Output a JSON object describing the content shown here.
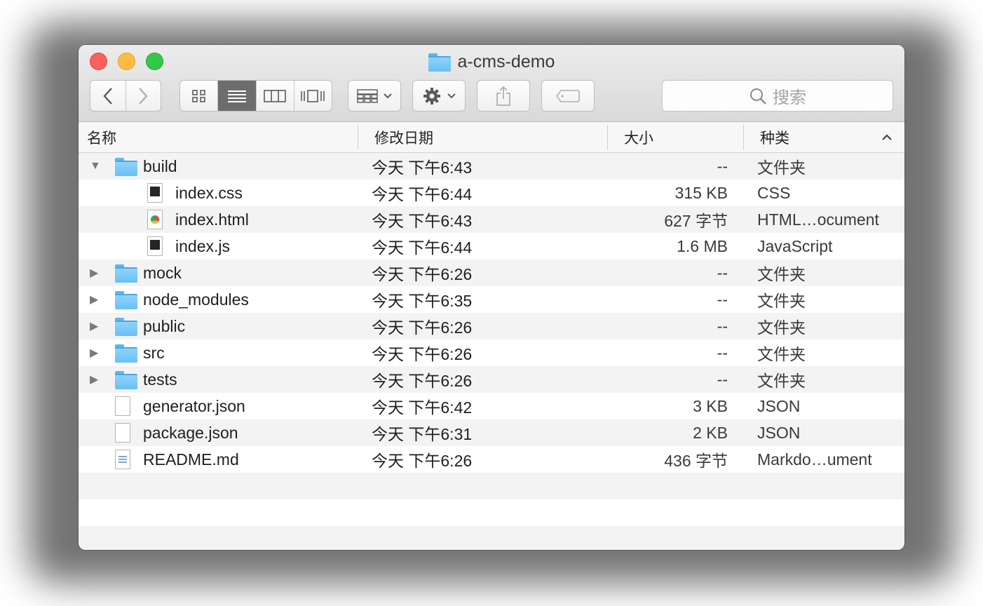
{
  "window": {
    "title": "a-cms-demo"
  },
  "toolbar": {
    "back_icon": "chevron-left-icon",
    "forward_icon": "chevron-right-icon",
    "view_modes": [
      "icon-view",
      "list-view",
      "column-view",
      "cover-flow-view"
    ],
    "active_view": "list-view",
    "search_placeholder": "搜索"
  },
  "columns": {
    "name": "名称",
    "date": "修改日期",
    "size": "大小",
    "kind": "种类"
  },
  "rows": [
    {
      "name": "build",
      "date": "今天 下午6:43",
      "size": "--",
      "kind": "文件夹",
      "type": "folder",
      "disclosure": "▼",
      "indent": 0
    },
    {
      "name": "index.css",
      "date": "今天 下午6:44",
      "size": "315 KB",
      "kind": "CSS",
      "type": "dark",
      "disclosure": "",
      "indent": 1
    },
    {
      "name": "index.html",
      "date": "今天 下午6:43",
      "size": "627 字节",
      "kind": "HTML…ocument",
      "type": "chrome",
      "disclosure": "",
      "indent": 1
    },
    {
      "name": "index.js",
      "date": "今天 下午6:44",
      "size": "1.6 MB",
      "kind": "JavaScript",
      "type": "dark",
      "disclosure": "",
      "indent": 1
    },
    {
      "name": "mock",
      "date": "今天 下午6:26",
      "size": "--",
      "kind": "文件夹",
      "type": "folder",
      "disclosure": "▶",
      "indent": 0
    },
    {
      "name": "node_modules",
      "date": "今天 下午6:35",
      "size": "--",
      "kind": "文件夹",
      "type": "folder",
      "disclosure": "▶",
      "indent": 0
    },
    {
      "name": "public",
      "date": "今天 下午6:26",
      "size": "--",
      "kind": "文件夹",
      "type": "folder",
      "disclosure": "▶",
      "indent": 0
    },
    {
      "name": "src",
      "date": "今天 下午6:26",
      "size": "--",
      "kind": "文件夹",
      "type": "folder",
      "disclosure": "▶",
      "indent": 0
    },
    {
      "name": "tests",
      "date": "今天 下午6:26",
      "size": "--",
      "kind": "文件夹",
      "type": "folder",
      "disclosure": "▶",
      "indent": 0
    },
    {
      "name": "generator.json",
      "date": "今天 下午6:42",
      "size": "3 KB",
      "kind": "JSON",
      "type": "plain",
      "disclosure": "",
      "indent": 0
    },
    {
      "name": "package.json",
      "date": "今天 下午6:31",
      "size": "2 KB",
      "kind": "JSON",
      "type": "plain",
      "disclosure": "",
      "indent": 0
    },
    {
      "name": "README.md",
      "date": "今天 下午6:26",
      "size": "436 字节",
      "kind": "Markdo…ument",
      "type": "md",
      "disclosure": "",
      "indent": 0
    }
  ]
}
